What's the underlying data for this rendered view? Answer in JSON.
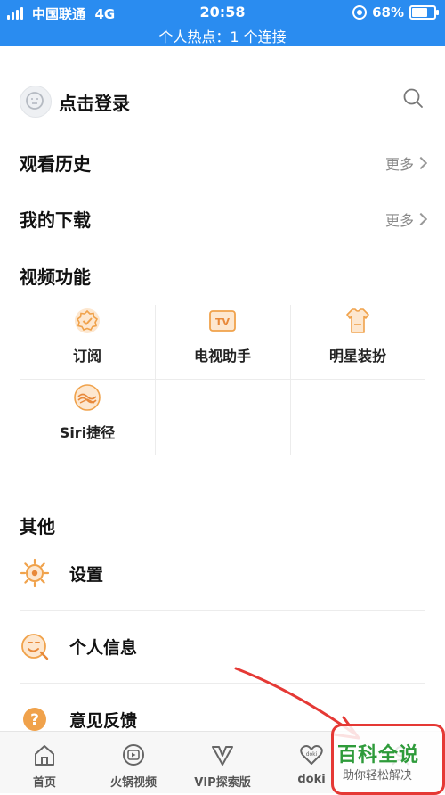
{
  "status_bar": {
    "carrier": "中国联通",
    "network": "4G",
    "time": "20:58",
    "battery": "68%",
    "battery_level": 0.68,
    "hotspot_text": "个人热点：1 个连接"
  },
  "login": {
    "label": "点击登录",
    "avatar_icon": "avatar-icon",
    "search_icon": "search-icon"
  },
  "history": {
    "title": "观看历史",
    "more": "更多"
  },
  "downloads": {
    "title": "我的下载",
    "more": "更多"
  },
  "video_functions": {
    "title": "视频功能",
    "items": [
      {
        "label": "订阅",
        "icon": "subscribe-badge-icon"
      },
      {
        "label": "电视助手",
        "icon": "tv-icon"
      },
      {
        "label": "明星装扮",
        "icon": "star-outfit-icon"
      },
      {
        "label": "Siri捷径",
        "icon": "siri-shortcut-icon"
      }
    ]
  },
  "other": {
    "title": "其他",
    "items": [
      {
        "label": "设置",
        "icon": "settings-gear-icon"
      },
      {
        "label": "个人信息",
        "icon": "personal-info-icon"
      },
      {
        "label": "意见反馈",
        "icon": "feedback-question-icon"
      }
    ]
  },
  "tabbar": {
    "items": [
      {
        "label": "首页",
        "icon": "home-icon"
      },
      {
        "label": "火锅视频",
        "icon": "hotpot-video-icon"
      },
      {
        "label": "VIP探索版",
        "icon": "vip-icon"
      },
      {
        "label": "doki",
        "icon": "doki-heart-icon"
      },
      {
        "label": "",
        "icon": "me-icon"
      }
    ]
  },
  "watermark": {
    "main": "百科全说",
    "sub": "助你轻松解决"
  },
  "colors": {
    "status_bar_bg": "#2a8cf0",
    "icon_orange": "#f0a24b",
    "annotation_red": "#e53935",
    "watermark_green": "#2e9b3a"
  }
}
